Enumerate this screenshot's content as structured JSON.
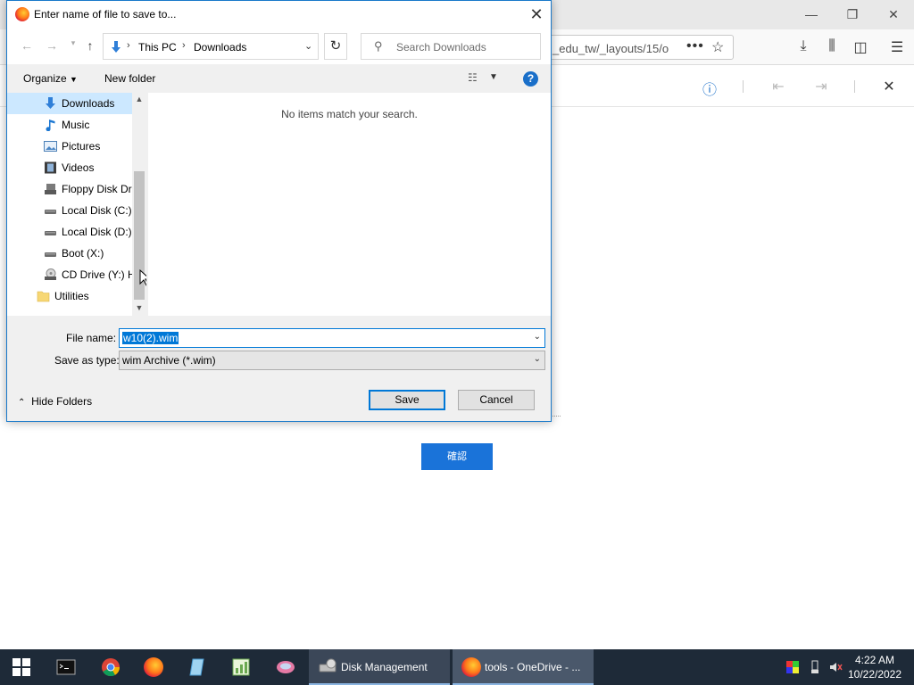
{
  "browser": {
    "url_fragment": "_edu_tw/_layouts/15/o",
    "url_more": "•••",
    "page_button_label": "確認"
  },
  "dialog": {
    "title": "Enter name of file to save to...",
    "breadcrumb": [
      "This PC",
      "Downloads"
    ],
    "search_placeholder": "Search Downloads",
    "toolbar": {
      "organize": "Organize",
      "new_folder": "New folder"
    },
    "nav_items": [
      {
        "label": "Downloads",
        "icon": "download-arrow-icon"
      },
      {
        "label": "Music",
        "icon": "music-note-icon"
      },
      {
        "label": "Pictures",
        "icon": "pictures-icon"
      },
      {
        "label": "Videos",
        "icon": "film-icon"
      },
      {
        "label": "Floppy Disk Dri",
        "icon": "floppy-drive-icon"
      },
      {
        "label": "Local Disk (C:)",
        "icon": "hard-drive-icon"
      },
      {
        "label": "Local Disk (D:)",
        "icon": "hard-drive-icon"
      },
      {
        "label": "Boot (X:)",
        "icon": "hard-drive-icon"
      },
      {
        "label": "CD Drive (Y:) H",
        "icon": "cd-drive-icon"
      },
      {
        "label": "Utilities",
        "icon": "folder-icon"
      }
    ],
    "empty_message": "No items match your search.",
    "file_name_label": "File name:",
    "file_name_value": "w10(2).wim",
    "save_type_label": "Save as type:",
    "save_type_value": "wim Archive (*.wim)",
    "hide_folders": "Hide Folders",
    "save_button": "Save",
    "cancel_button": "Cancel"
  },
  "taskbar": {
    "tasks": [
      {
        "label": "Disk Management"
      },
      {
        "label": "tools - OneDrive - ..."
      }
    ],
    "time": "4:22 AM",
    "date": "10/22/2022"
  },
  "colors": {
    "accent": "#0078d7",
    "taskbar": "#1e2a38",
    "nav_selected": "#cce8ff"
  }
}
